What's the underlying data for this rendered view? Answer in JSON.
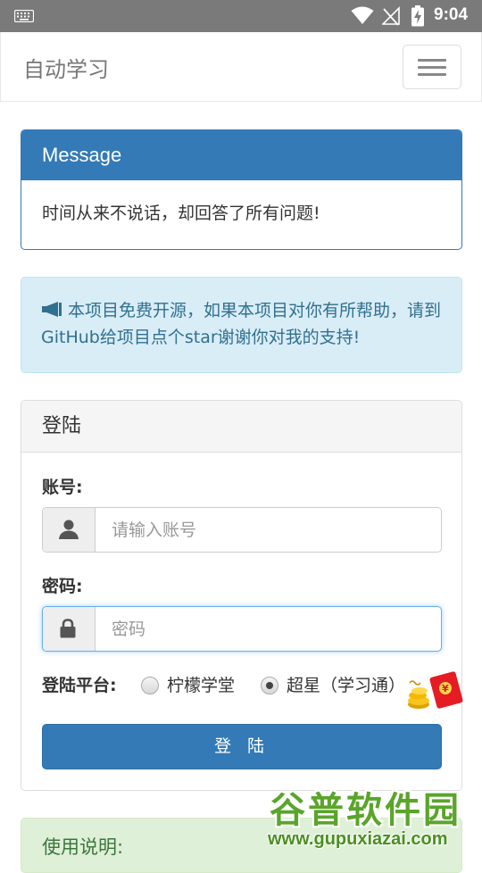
{
  "status_bar": {
    "time": "9:04"
  },
  "navbar": {
    "brand": "自动学习"
  },
  "message_panel": {
    "title": "Message",
    "body": "时间从来不说话，却回答了所有问题!"
  },
  "info_alert": {
    "text": "本项目免费开源，如果本项目对你有所帮助，请到GitHub给项目点个star谢谢你对我的支持!"
  },
  "login_panel": {
    "title": "登陆",
    "account_label": "账号:",
    "account_placeholder": "请输入账号",
    "password_label": "密码:",
    "password_placeholder": "密码",
    "platform_label": "登陆平台:",
    "platforms": [
      {
        "label": "柠檬学堂",
        "checked": false
      },
      {
        "label": "超星（学习通）",
        "checked": true
      }
    ],
    "login_button": "登 陆"
  },
  "usage_alert": {
    "title": "使用说明:"
  },
  "watermark": {
    "name": "谷普软件园",
    "url": "www.gupuxiazai.com"
  },
  "colors": {
    "primary": "#337ab7",
    "info_bg": "#d9edf7",
    "info_text": "#31708f",
    "success_bg": "#dff0d8",
    "status_bar": "#7a7a7a"
  }
}
